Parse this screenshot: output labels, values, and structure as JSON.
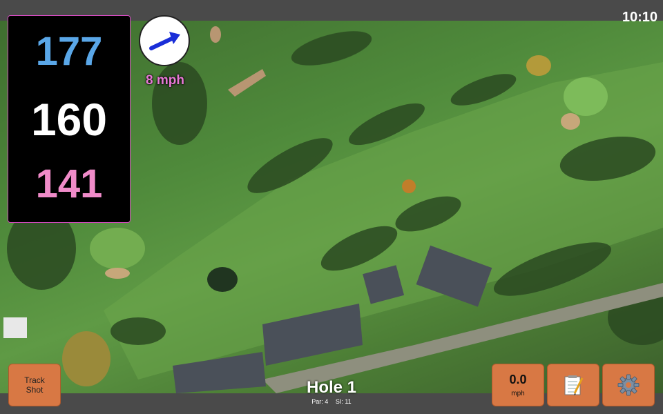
{
  "status": {
    "time": "10:10"
  },
  "distances": {
    "back": "177",
    "middle": "160",
    "front": "141"
  },
  "wind": {
    "speed": "8 mph",
    "icon": "wind-arrow-icon"
  },
  "track_button": {
    "line1": "Track",
    "line2": "Shot"
  },
  "speed_button": {
    "value": "0.0",
    "unit": "mph"
  },
  "notes_button": {
    "icon": "notepad-icon"
  },
  "settings_button": {
    "icon": "gear-icon"
  },
  "hole": {
    "title": "Hole 1",
    "par": "Par: 4",
    "si": "SI: 11"
  },
  "colors": {
    "back": "#5aa7e8",
    "middle": "#ffffff",
    "front": "#f08bc9",
    "wind_text": "#e879d6",
    "button": "#d87844",
    "panel_border": "#d44cc0"
  }
}
